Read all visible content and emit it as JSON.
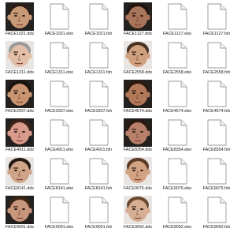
{
  "files": [
    {
      "name": "FACE1021.dds",
      "type": "dds",
      "skin": "#c89a78",
      "hair": "#2a1c14",
      "mood": "dark"
    },
    {
      "name": "FACE1021.ebo",
      "type": "ebo"
    },
    {
      "name": "FACE1021.fsh",
      "type": "fsh"
    },
    {
      "name": "FACE1127.dds",
      "type": "dds",
      "skin": "#a8745a",
      "hair": "#201410",
      "mood": "dark"
    },
    {
      "name": "FACE1127.ebo",
      "type": "ebo"
    },
    {
      "name": "FACE1127.fsh",
      "type": "fsh"
    },
    {
      "name": "FACE1311.dds",
      "type": "dds",
      "skin": "#e3bfa8",
      "hair": "#9a9a9a",
      "mood": "light"
    },
    {
      "name": "FACE1311.ebo",
      "type": "ebo"
    },
    {
      "name": "FACE1311.fsh",
      "type": "fsh"
    },
    {
      "name": "FACE2558.dds",
      "type": "dds",
      "skin": "#cfa07e",
      "hair": "#4a3020",
      "mood": "light"
    },
    {
      "name": "FACE2558.ebo",
      "type": "ebo"
    },
    {
      "name": "FACE2558.fsh",
      "type": "fsh"
    },
    {
      "name": "FACE2937.dds",
      "type": "dds",
      "skin": "#c99470",
      "hair": "#1a120c",
      "mood": "dark"
    },
    {
      "name": "FACE2937.ebo",
      "type": "ebo"
    },
    {
      "name": "FACE2937.fsh",
      "type": "fsh"
    },
    {
      "name": "FACE4574.dds",
      "type": "dds",
      "skin": "#b27a58",
      "hair": "#2a1a10",
      "mood": "dark"
    },
    {
      "name": "FACE4574.ebo",
      "type": "ebo"
    },
    {
      "name": "FACE4574.fsh",
      "type": "fsh"
    },
    {
      "name": "FACE4911.dds",
      "type": "dds",
      "skin": "#d89a8a",
      "hair": "#3a2418",
      "mood": "dark"
    },
    {
      "name": "FACE4911.ebo",
      "type": "ebo"
    },
    {
      "name": "FACE4911.fsh",
      "type": "fsh"
    },
    {
      "name": "FACE8354.dds",
      "type": "dds",
      "skin": "#b8806a",
      "hair": "#2a1a12",
      "mood": "dark"
    },
    {
      "name": "FACE8354.ebo",
      "type": "ebo"
    },
    {
      "name": "FACE8354.fsh",
      "type": "fsh"
    },
    {
      "name": "FACE8141.dds",
      "type": "dds",
      "skin": "#d0a488",
      "hair": "#241810",
      "mood": "light"
    },
    {
      "name": "FACE8141.ebo",
      "type": "ebo"
    },
    {
      "name": "FACE8141.fsh",
      "type": "fsh"
    },
    {
      "name": "FACE9075.dds",
      "type": "dds",
      "skin": "#d2a282",
      "hair": "#5a3a24",
      "mood": "light"
    },
    {
      "name": "FACE9075.ebo",
      "type": "ebo"
    },
    {
      "name": "FACE9075.fsh",
      "type": "fsh"
    },
    {
      "name": "FACE9091.dds",
      "type": "dds",
      "skin": "#c8967c",
      "hair": "#3a2416",
      "mood": "dark"
    },
    {
      "name": "FACE9091.ebo",
      "type": "ebo"
    },
    {
      "name": "FACE9091.fsh",
      "type": "fsh"
    },
    {
      "name": "FACE9092.dds",
      "type": "dds",
      "skin": "#d6ae94",
      "hair": "#6a4a30",
      "mood": "light"
    },
    {
      "name": "FACE9092.ebo",
      "type": "ebo"
    },
    {
      "name": "FACE9092.fsh",
      "type": "fsh"
    }
  ],
  "icons": {
    "dds": "face-texture-thumbnail-icon",
    "ebo": "blank-document-icon",
    "fsh": "blank-document-icon"
  }
}
